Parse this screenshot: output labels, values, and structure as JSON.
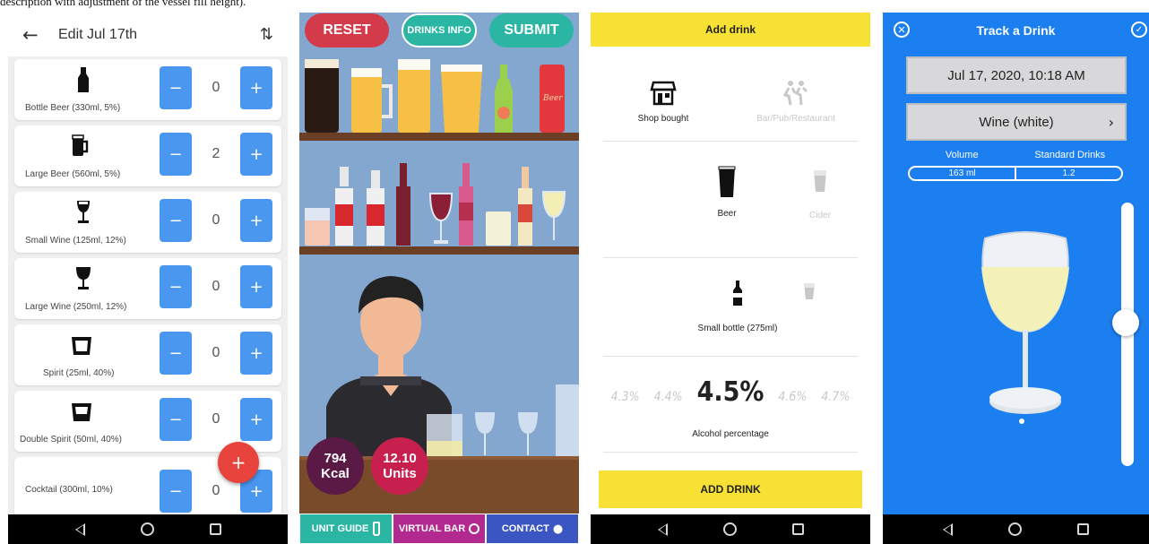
{
  "caption": "description with adjustment of the vessel fill height).",
  "screen1": {
    "title": "Edit Jul 17th",
    "drinks": [
      {
        "name": "Bottle Beer (330ml, 5%)",
        "count": "0"
      },
      {
        "name": "Large Beer (560ml, 5%)",
        "count": "2"
      },
      {
        "name": "Small Wine (125ml, 12%)",
        "count": "0"
      },
      {
        "name": "Large Wine (250ml, 12%)",
        "count": "0"
      },
      {
        "name": "Spirit (25ml, 40%)",
        "count": "0"
      },
      {
        "name": "Double Spirit (50ml, 40%)",
        "count": "0"
      },
      {
        "name": "Cocktail  (300ml, 10%)",
        "count": "0"
      }
    ],
    "minus": "−",
    "plus": "+",
    "fab": "+"
  },
  "screen2": {
    "reset": "RESET",
    "drinks_info": "DRINKS INFO",
    "submit": "SUBMIT",
    "kcal_value": "794",
    "kcal_label": "Kcal",
    "units_value": "12.10",
    "units_label": "Units",
    "unit_guide": "UNIT GUIDE",
    "virtual_bar": "VIRTUAL BAR",
    "contact": "CONTACT",
    "can_text": "Beer"
  },
  "screen3": {
    "header": "Add drink",
    "source_selected": "Shop bought",
    "source_other": "Bar/Pub/Restaurant",
    "type_selected": "Beer",
    "type_other": "Cider",
    "size_label": "Small bottle (275ml)",
    "percentages": [
      "4.3%",
      "4.4%",
      "4.5%",
      "4.6%",
      "4.7%"
    ],
    "percentage_label": "Alcohol percentage",
    "add_button": "ADD DRINK"
  },
  "screen4": {
    "title": "Track a Drink",
    "datetime": "Jul 17, 2020, 10:18 AM",
    "drink": "Wine (white)",
    "volume_label": "Volume",
    "std_label": "Standard Drinks",
    "volume_value": "163 ml",
    "std_value": "1.2",
    "fill_level": 0.45
  },
  "colors": {
    "blue_button": "#4a97f0",
    "fab_red": "#e8433c",
    "yellow": "#f8e135",
    "track_blue": "#1b7ff0",
    "reset_red": "#d33b4b",
    "teal": "#2bb6a4"
  }
}
